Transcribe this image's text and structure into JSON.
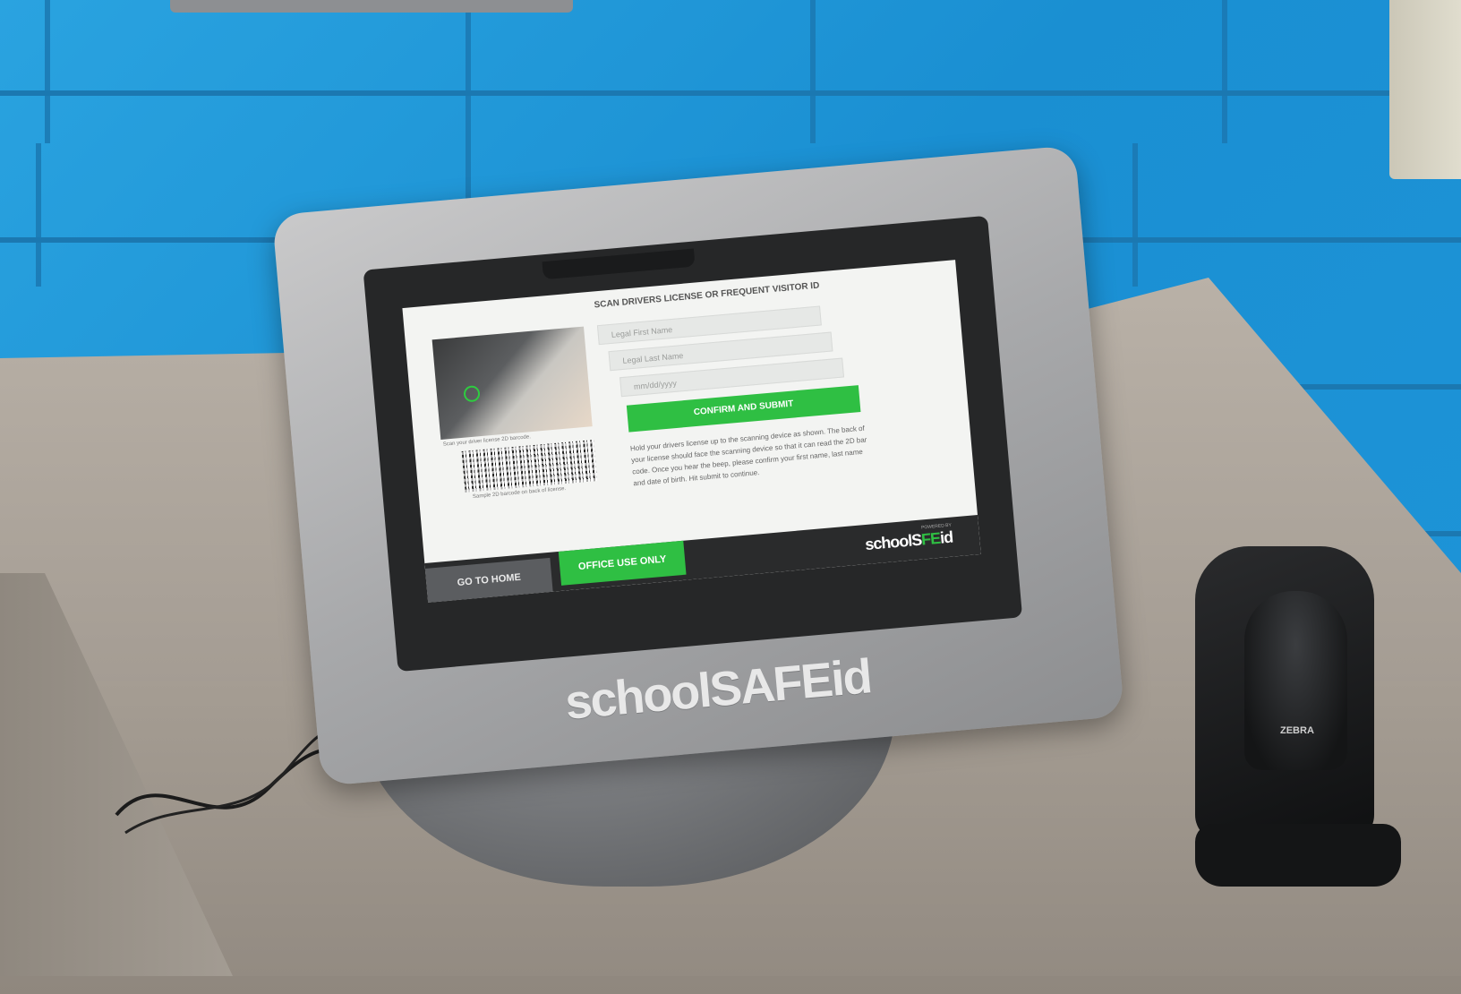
{
  "screen": {
    "title": "SCAN DRIVERS LICENSE OR FREQUENT VISITOR ID",
    "fields": {
      "first_name_placeholder": "Legal First Name",
      "last_name_placeholder": "Legal Last Name",
      "dob_placeholder": "mm/dd/yyyy"
    },
    "confirm_label": "CONFIRM AND SUBMIT",
    "instructions": "Hold your drivers license up to the scanning device as shown. The back of your license should face the scanning device so that it can read the 2D bar code. Once you hear the beep, please confirm your first name, last name and date of birth. Hit submit to continue.",
    "photo_caption": "Scan your driver license 2D barcode.",
    "barcode_caption": "Sample 2D barcode on back of license.",
    "footer": {
      "home_label": "GO TO HOME",
      "office_label": "OFFICE USE ONLY",
      "powered_by": "POWERED BY",
      "brand_plain": "schoolS",
      "brand_green": "FE",
      "brand_end": "id"
    }
  },
  "kiosk": {
    "bezel_brand": "schoolSAFEid"
  },
  "scanner": {
    "brand": "ZEBRA"
  },
  "colors": {
    "wall": "#1f95d6",
    "accent_green": "#2fbf43",
    "bezel": "#a8a9ab"
  }
}
